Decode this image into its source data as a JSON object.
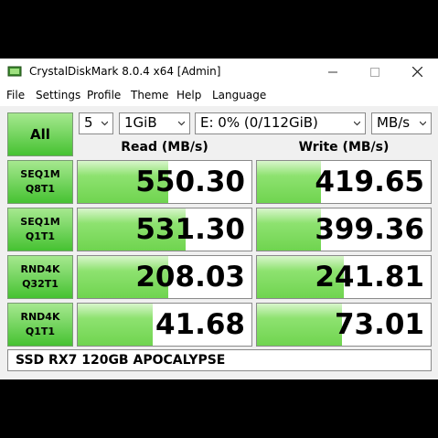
{
  "window": {
    "title": "CrystalDiskMark 8.0.4 x64 [Admin]"
  },
  "menu": [
    "File",
    "Settings",
    "Profile",
    "Theme",
    "Help",
    "Language"
  ],
  "toolbar": {
    "all_label": "All",
    "count": "5",
    "size": "1GiB",
    "drive": "E: 0% (0/112GiB)",
    "unit": "MB/s"
  },
  "headers": {
    "read": "Read (MB/s)",
    "write": "Write (MB/s)"
  },
  "results": [
    {
      "line1": "SEQ1M",
      "line2": "Q8T1",
      "read": "550.30",
      "write": "419.65",
      "read_fill": 0.52,
      "write_fill": 0.37
    },
    {
      "line1": "SEQ1M",
      "line2": "Q1T1",
      "read": "531.30",
      "write": "399.36",
      "read_fill": 0.62,
      "write_fill": 0.37
    },
    {
      "line1": "RND4K",
      "line2": "Q32T1",
      "read": "208.03",
      "write": "241.81",
      "read_fill": 0.52,
      "write_fill": 0.5
    },
    {
      "line1": "RND4K",
      "line2": "Q1T1",
      "read": "41.68",
      "write": "73.01",
      "read_fill": 0.43,
      "write_fill": 0.49
    }
  ],
  "comment": "SSD RX7 120GB APOCALYPSE",
  "colors": {
    "accent_green": "#46c232",
    "bar_green": "#6fd44f"
  }
}
